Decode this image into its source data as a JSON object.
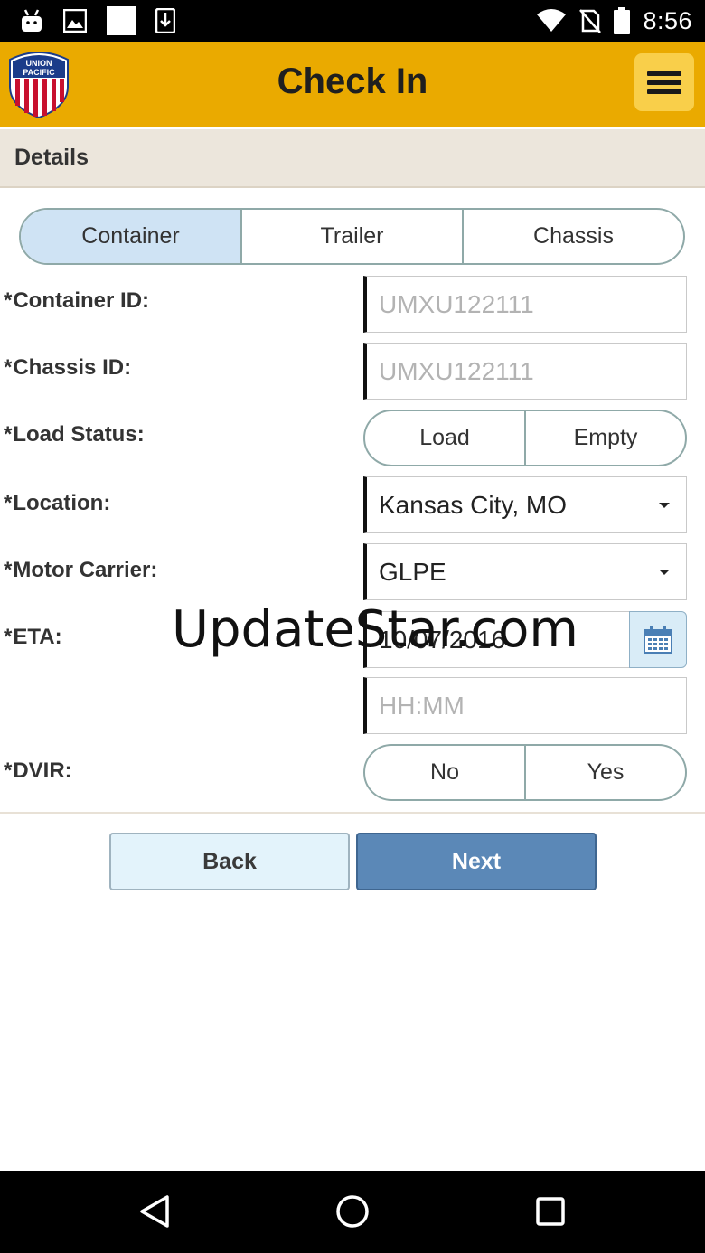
{
  "status_bar": {
    "time": "8:56",
    "left_icons": [
      "android-icon",
      "image-icon",
      "square-icon",
      "download-icon"
    ],
    "right_icons": [
      "wifi-icon",
      "no-sim-icon",
      "battery-icon"
    ]
  },
  "header": {
    "logo_text_line1": "UNION",
    "logo_text_line2": "PACIFIC",
    "title": "Check In",
    "menu_icon": "hamburger-icon",
    "background_color": "#eaaa00"
  },
  "details": {
    "title": "Details"
  },
  "tabs": [
    {
      "label": "Container",
      "active": true
    },
    {
      "label": "Trailer",
      "active": false
    },
    {
      "label": "Chassis",
      "active": false
    }
  ],
  "form": {
    "required_marker": "*",
    "container_id": {
      "label": "Container ID:",
      "placeholder": "UMXU122111"
    },
    "chassis_id": {
      "label": "Chassis ID:",
      "placeholder": "UMXU122111"
    },
    "load_status": {
      "label": "Load Status:",
      "options": [
        "Load",
        "Empty"
      ]
    },
    "location": {
      "label": "Location:",
      "value": "Kansas City, MO"
    },
    "motor_carrier": {
      "label": "Motor Carrier:",
      "value": "GLPE"
    },
    "eta": {
      "label": "ETA:",
      "date": "10/07/2016",
      "time_placeholder": "HH:MM"
    },
    "dvir": {
      "label": "DVIR:",
      "options": [
        "No",
        "Yes"
      ]
    }
  },
  "watermark": "UpdateStar.com",
  "buttons": {
    "back": "Back",
    "next": "Next"
  },
  "nav_bar": {
    "icons": [
      "back-triangle-icon",
      "home-circle-icon",
      "recents-square-icon"
    ]
  }
}
